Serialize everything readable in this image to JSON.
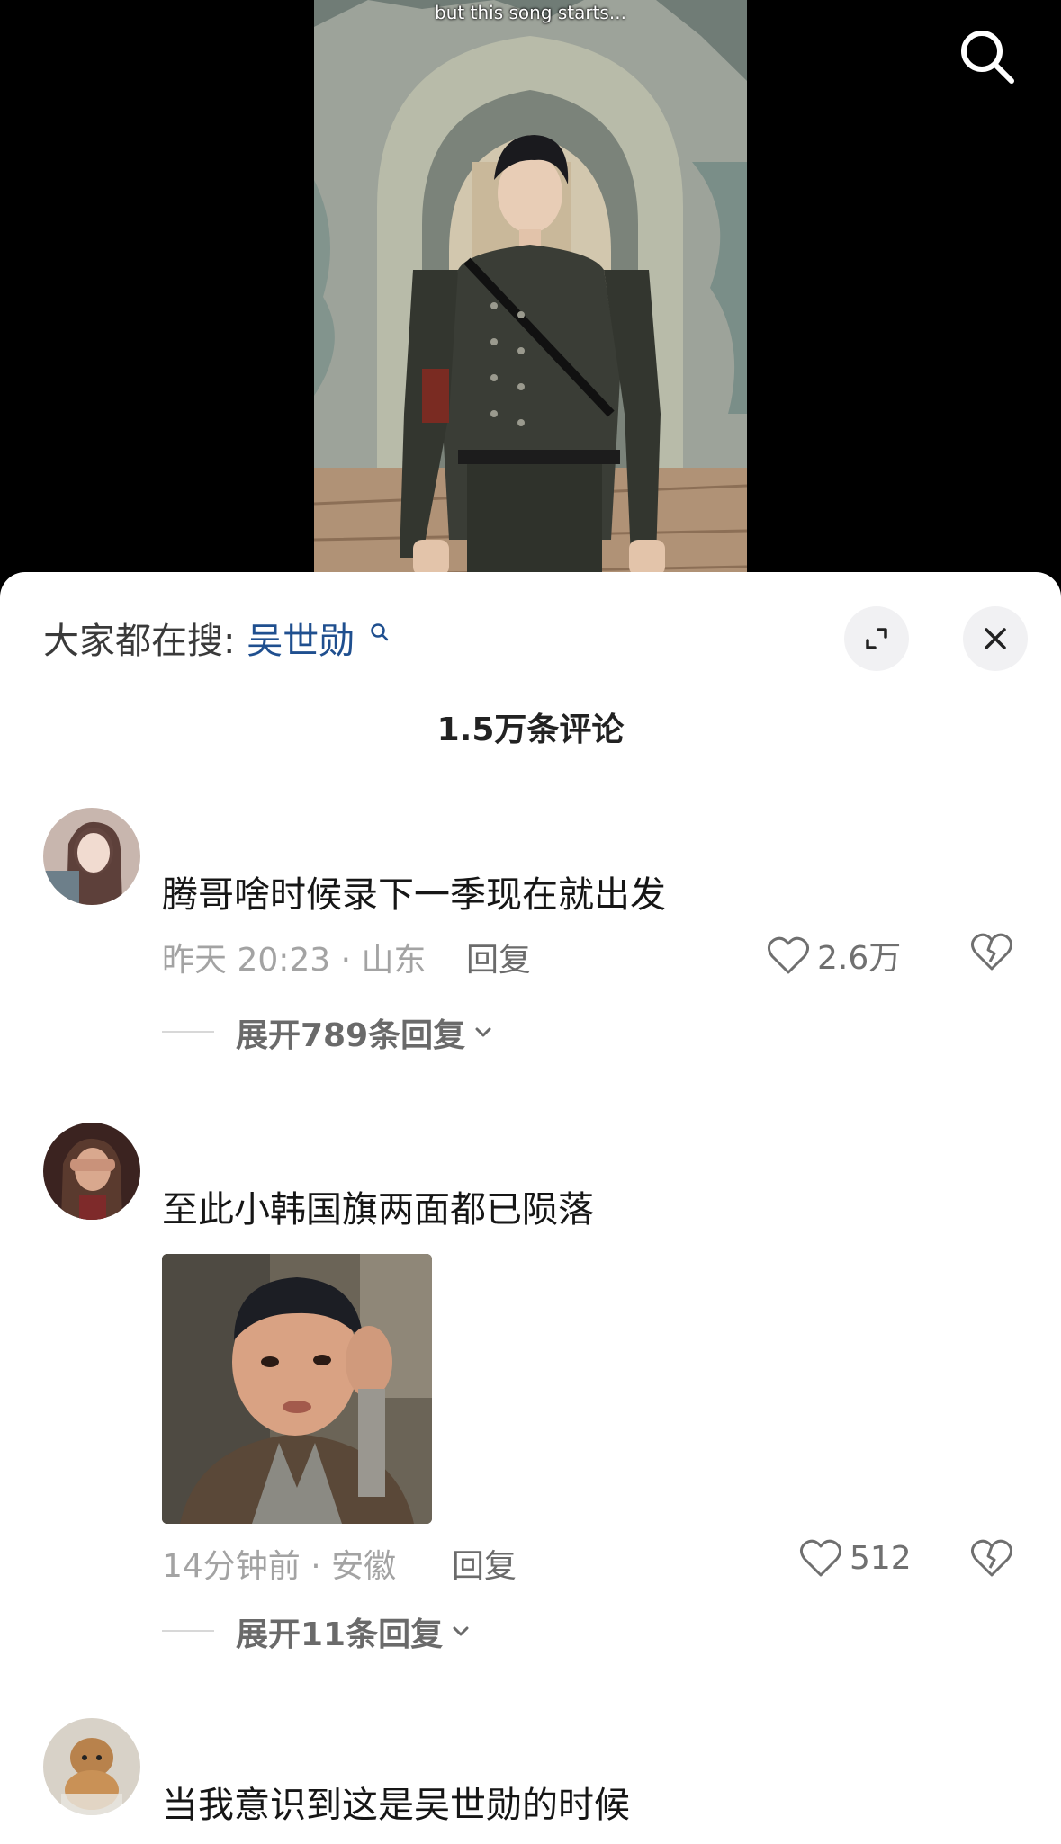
{
  "video": {
    "caption": "but this song starts...",
    "search_icon": "search-icon"
  },
  "sheet": {
    "hot_search_label": "大家都在搜:",
    "hot_search_keyword": "吴世勋",
    "comment_count": "1.5万条评论",
    "expand_icon": "expand-icon",
    "close_icon": "close-icon"
  },
  "comments": [
    {
      "text": "腾哥啥时候录下一季现在就出发",
      "time_location": "昨天 20:23 · 山东",
      "reply_label": "回复",
      "likes": "2.6万",
      "expand_replies": "展开789条回复"
    },
    {
      "text": "至此小韩国旗两面都已陨落",
      "has_sticker": true,
      "time_location": "14分钟前 · 安徽",
      "reply_label": "回复",
      "likes": "512",
      "expand_replies": "展开11条回复"
    },
    {
      "text": "当我意识到这是吴世勋的时候"
    }
  ]
}
